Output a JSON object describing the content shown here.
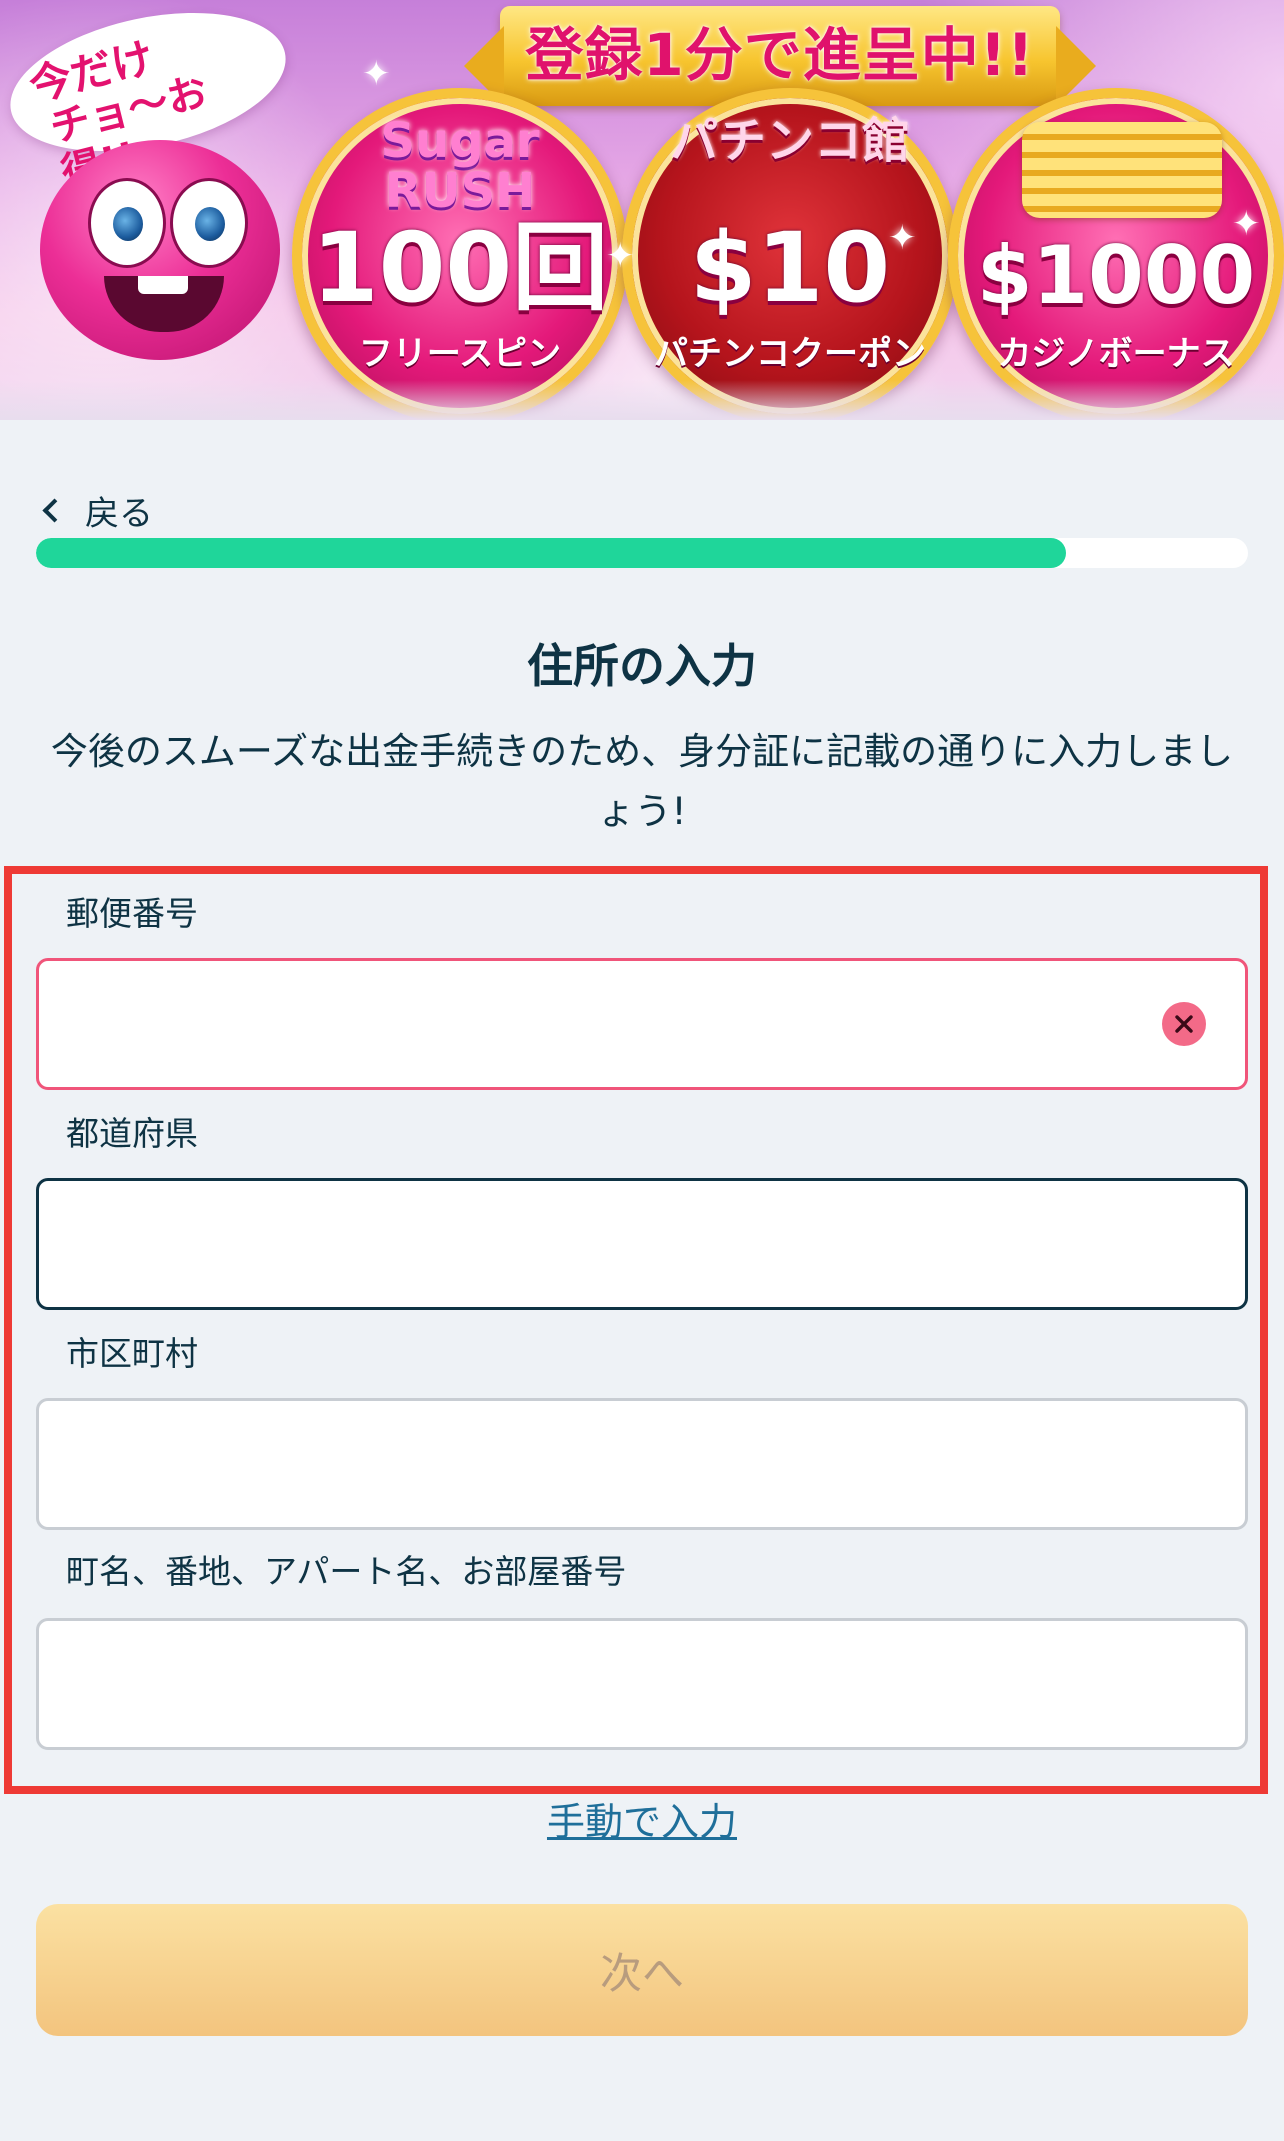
{
  "banner": {
    "promo_line1": "今だけ",
    "promo_line2": "チョ〜お得!!",
    "headline": "登録1分で進呈中!!",
    "offers": [
      {
        "game_logo": "Sugar RUSH",
        "value": "100回",
        "caption": "フリースピン"
      },
      {
        "game_logo": "パチンコ館",
        "value": "$10",
        "caption": "パチンコクーポン"
      },
      {
        "game_logo": "",
        "value": "$1000",
        "caption": "カジノボーナス"
      }
    ]
  },
  "nav": {
    "back_label": "戻る"
  },
  "progress": {
    "fraction": 0.85,
    "fill_color": "#1fd69a"
  },
  "heading": {
    "title": "住所の入力",
    "subtitle": "今後のスムーズな出金手続きのため、身分証に記載の通りに入力しましょう!"
  },
  "form": {
    "fields": [
      {
        "label": "郵便番号",
        "value": "",
        "state": "error"
      },
      {
        "label": "都道府県",
        "value": "",
        "state": "focused"
      },
      {
        "label": "市区町村",
        "value": "",
        "state": "default"
      },
      {
        "label": "町名、番地、アパート名、お部屋番号",
        "value": "",
        "state": "default"
      }
    ],
    "clear_icon": "close-icon",
    "manual_link": "手動で入力"
  },
  "actions": {
    "next_label": "次へ"
  },
  "colors": {
    "accent": "#1fd69a",
    "error": "#f0557a",
    "highlight_frame": "#ee3a35",
    "text": "#0e3344",
    "button": "#f3c47e"
  }
}
